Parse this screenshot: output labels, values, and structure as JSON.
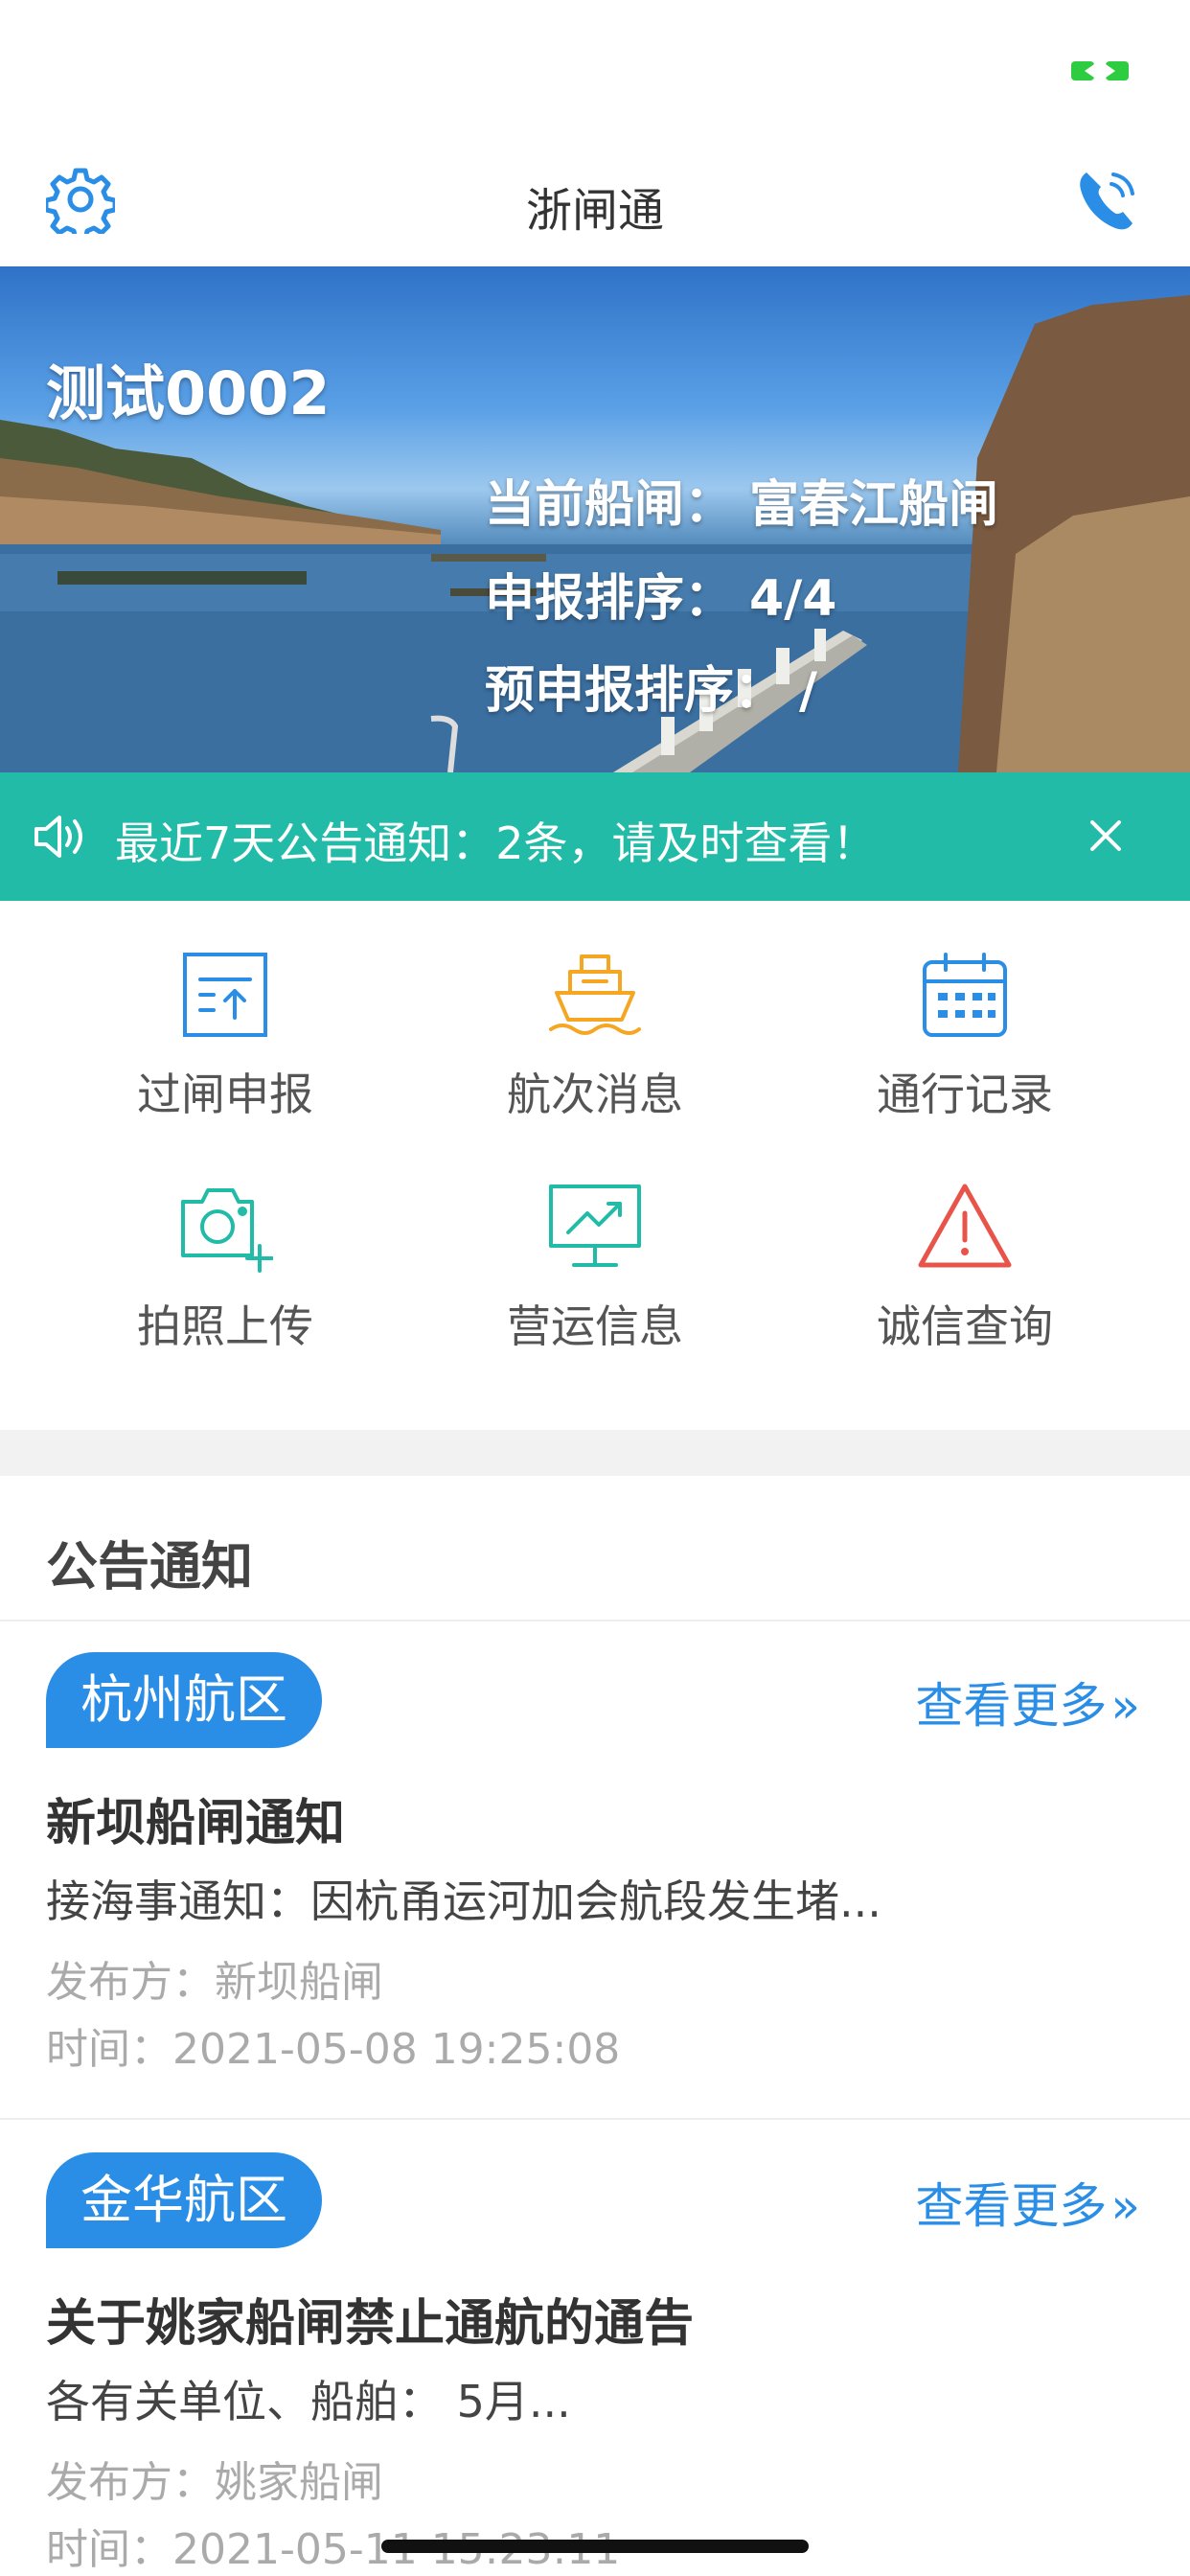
{
  "nav": {
    "title": "浙闸通",
    "settings_icon": "gear-icon",
    "phone_icon": "phone-icon"
  },
  "hero": {
    "vessel_name": "测试0002",
    "current_lock_label": "当前船闸：",
    "current_lock_value": "富春江船闸",
    "report_order_label": "申报排序：",
    "report_order_value": "4/4",
    "pre_report_order_label": "预申报排序：",
    "pre_report_order_value": "/"
  },
  "notice": {
    "text": "最近7天公告通知：2条，请及时查看！",
    "speaker_icon": "speaker-icon",
    "close_icon": "close-icon"
  },
  "grid": {
    "items": [
      {
        "label": "过闸申报",
        "icon": "upload-document-icon",
        "color": "#2a8ee6"
      },
      {
        "label": "航次消息",
        "icon": "ship-icon",
        "color": "#f5a623"
      },
      {
        "label": "通行记录",
        "icon": "calendar-icon",
        "color": "#2a8ee6"
      },
      {
        "label": "拍照上传",
        "icon": "camera-plus-icon",
        "color": "#22bba8"
      },
      {
        "label": "营运信息",
        "icon": "monitor-chart-icon",
        "color": "#22bba8"
      },
      {
        "label": "诚信查询",
        "icon": "warning-icon",
        "color": "#e8534a"
      }
    ]
  },
  "announcements": {
    "header": "公告通知",
    "more_label": "查看更多",
    "items": [
      {
        "region": "杭州航区",
        "title": "新坝船闸通知",
        "summary": "接海事通知：因杭甬运河加会航段发生堵...",
        "publisher": "发布方：新坝船闸",
        "time": "时间：2021-05-08 19:25:08"
      },
      {
        "region": "金华航区",
        "title": "关于姚家船闸禁止通航的通告",
        "summary": "各有关单位、船舶： 5月...",
        "publisher": "发布方：姚家船闸",
        "time": "时间：2021-05-11 15:23:11"
      }
    ]
  },
  "colors": {
    "primary": "#2a8ee6",
    "teal": "#22bba8",
    "orange": "#f5a623",
    "red": "#e8534a",
    "battery": "#2ecc40"
  }
}
